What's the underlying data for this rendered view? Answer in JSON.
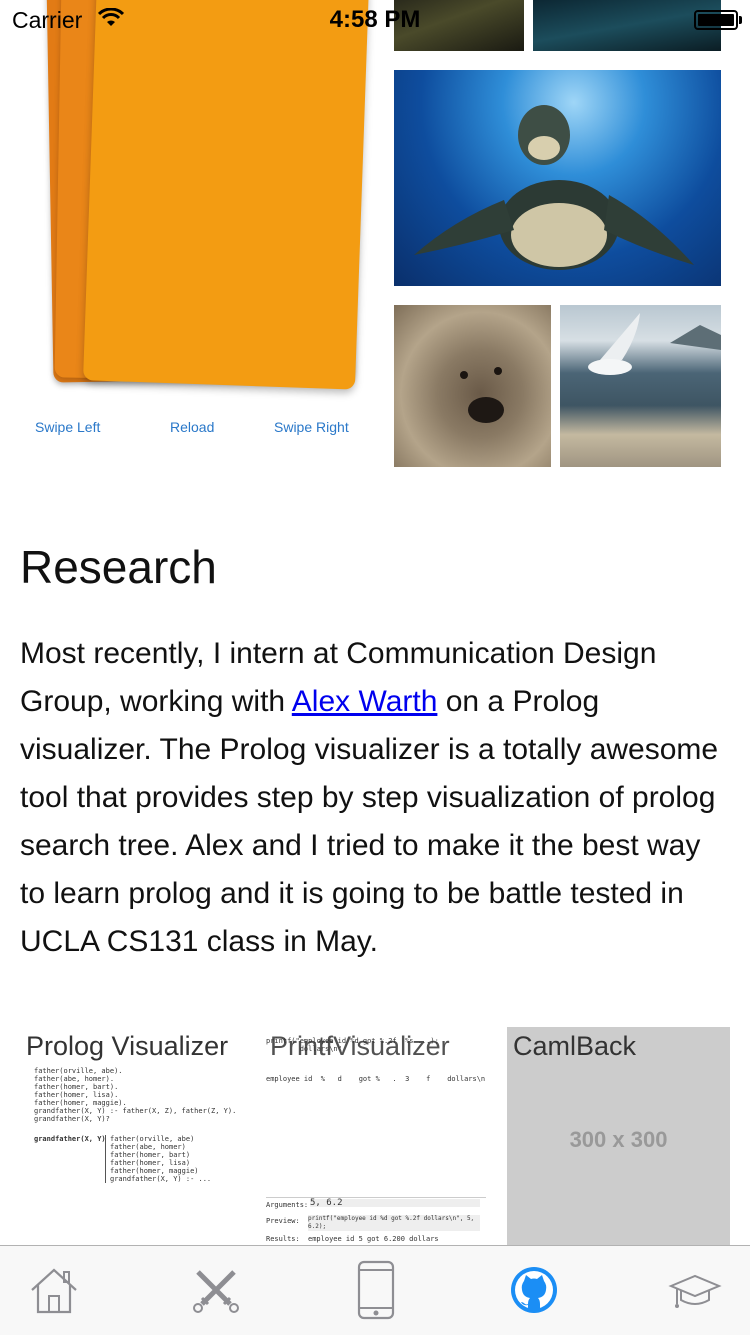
{
  "status_bar": {
    "carrier": "Carrier",
    "time": "4:58 PM"
  },
  "card_controls": {
    "swipe_left": "Swipe Left",
    "reload": "Reload",
    "swipe_right": "Swipe Right"
  },
  "research": {
    "heading": "Research",
    "text_before_link": "Most recently, I intern at Communication Design Group, working with ",
    "link_text": "Alex Warth",
    "text_after_link": " on a Prolog visualizer. The Prolog visualizer is a totally awesome tool that provides step by step visualization of prolog search tree. Alex and I tried to make it the best way to learn prolog and it is going to be battle tested in UCLA CS131 class in May."
  },
  "projects": [
    {
      "title": "Prolog Visualizer"
    },
    {
      "title": "PrintfVisualizer"
    },
    {
      "title": "CamlBack",
      "placeholder": "300 x 300"
    }
  ],
  "prolog_code": {
    "lines": "father(orville, abe).\nfather(abe, homer).\nfather(homer, bart).\nfather(homer, lisa).\nfather(homer, maggie).\ngrandfather(X, Y) :- father(X, Z), father(Z, Y).\ngrandfather(X, Y)?",
    "query": "grandfather(X, Y)",
    "results": "father(orville, abe)\nfather(abe, homer)\nfather(homer, bart)\nfather(homer, lisa)\nfather(homer, maggie)\ngrandfather(X, Y) :- ..."
  },
  "printf_code": {
    "top": "printf(\"employee id %d got %.2f  %s ...);\n        dollars\\n\"",
    "row": "employee id  %   d    got %   .  3    f    dollars\\n",
    "args_label": "Arguments:",
    "args_value": "5, 6.2",
    "preview_label": "Preview:",
    "preview_value": "printf(\"employee id %d got %.2f dollars\\n\", 5, 6.2);",
    "results_label": "Results:",
    "results_value": "employee id 5 got 6.200 dollars"
  },
  "tabs": [
    {
      "name": "home-icon"
    },
    {
      "name": "swords-icon"
    },
    {
      "name": "phone-icon"
    },
    {
      "name": "github-icon",
      "active": true
    },
    {
      "name": "graduation-cap-icon"
    }
  ],
  "colors": {
    "tint": "#2a78c9",
    "link": "#0000ee",
    "active_tab": "#1b8ef5",
    "inactive_tab": "#8e8e93"
  }
}
